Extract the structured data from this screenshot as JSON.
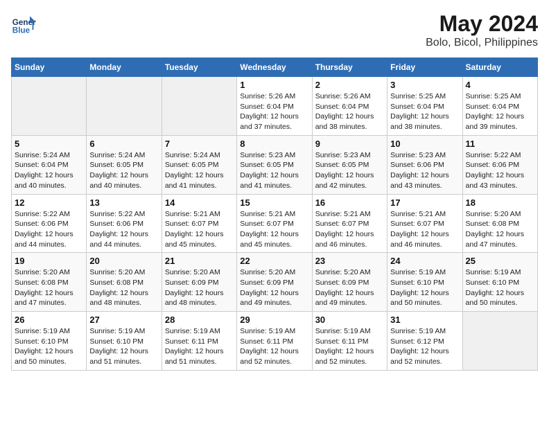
{
  "logo": {
    "line1": "General",
    "line2": "Blue"
  },
  "title": "May 2024",
  "subtitle": "Bolo, Bicol, Philippines",
  "weekdays": [
    "Sunday",
    "Monday",
    "Tuesday",
    "Wednesday",
    "Thursday",
    "Friday",
    "Saturday"
  ],
  "weeks": [
    [
      {
        "day": "",
        "sunrise": "",
        "sunset": "",
        "daylight": ""
      },
      {
        "day": "",
        "sunrise": "",
        "sunset": "",
        "daylight": ""
      },
      {
        "day": "",
        "sunrise": "",
        "sunset": "",
        "daylight": ""
      },
      {
        "day": "1",
        "sunrise": "Sunrise: 5:26 AM",
        "sunset": "Sunset: 6:04 PM",
        "daylight": "Daylight: 12 hours and 37 minutes."
      },
      {
        "day": "2",
        "sunrise": "Sunrise: 5:26 AM",
        "sunset": "Sunset: 6:04 PM",
        "daylight": "Daylight: 12 hours and 38 minutes."
      },
      {
        "day": "3",
        "sunrise": "Sunrise: 5:25 AM",
        "sunset": "Sunset: 6:04 PM",
        "daylight": "Daylight: 12 hours and 38 minutes."
      },
      {
        "day": "4",
        "sunrise": "Sunrise: 5:25 AM",
        "sunset": "Sunset: 6:04 PM",
        "daylight": "Daylight: 12 hours and 39 minutes."
      }
    ],
    [
      {
        "day": "5",
        "sunrise": "Sunrise: 5:24 AM",
        "sunset": "Sunset: 6:04 PM",
        "daylight": "Daylight: 12 hours and 40 minutes."
      },
      {
        "day": "6",
        "sunrise": "Sunrise: 5:24 AM",
        "sunset": "Sunset: 6:05 PM",
        "daylight": "Daylight: 12 hours and 40 minutes."
      },
      {
        "day": "7",
        "sunrise": "Sunrise: 5:24 AM",
        "sunset": "Sunset: 6:05 PM",
        "daylight": "Daylight: 12 hours and 41 minutes."
      },
      {
        "day": "8",
        "sunrise": "Sunrise: 5:23 AM",
        "sunset": "Sunset: 6:05 PM",
        "daylight": "Daylight: 12 hours and 41 minutes."
      },
      {
        "day": "9",
        "sunrise": "Sunrise: 5:23 AM",
        "sunset": "Sunset: 6:05 PM",
        "daylight": "Daylight: 12 hours and 42 minutes."
      },
      {
        "day": "10",
        "sunrise": "Sunrise: 5:23 AM",
        "sunset": "Sunset: 6:06 PM",
        "daylight": "Daylight: 12 hours and 43 minutes."
      },
      {
        "day": "11",
        "sunrise": "Sunrise: 5:22 AM",
        "sunset": "Sunset: 6:06 PM",
        "daylight": "Daylight: 12 hours and 43 minutes."
      }
    ],
    [
      {
        "day": "12",
        "sunrise": "Sunrise: 5:22 AM",
        "sunset": "Sunset: 6:06 PM",
        "daylight": "Daylight: 12 hours and 44 minutes."
      },
      {
        "day": "13",
        "sunrise": "Sunrise: 5:22 AM",
        "sunset": "Sunset: 6:06 PM",
        "daylight": "Daylight: 12 hours and 44 minutes."
      },
      {
        "day": "14",
        "sunrise": "Sunrise: 5:21 AM",
        "sunset": "Sunset: 6:07 PM",
        "daylight": "Daylight: 12 hours and 45 minutes."
      },
      {
        "day": "15",
        "sunrise": "Sunrise: 5:21 AM",
        "sunset": "Sunset: 6:07 PM",
        "daylight": "Daylight: 12 hours and 45 minutes."
      },
      {
        "day": "16",
        "sunrise": "Sunrise: 5:21 AM",
        "sunset": "Sunset: 6:07 PM",
        "daylight": "Daylight: 12 hours and 46 minutes."
      },
      {
        "day": "17",
        "sunrise": "Sunrise: 5:21 AM",
        "sunset": "Sunset: 6:07 PM",
        "daylight": "Daylight: 12 hours and 46 minutes."
      },
      {
        "day": "18",
        "sunrise": "Sunrise: 5:20 AM",
        "sunset": "Sunset: 6:08 PM",
        "daylight": "Daylight: 12 hours and 47 minutes."
      }
    ],
    [
      {
        "day": "19",
        "sunrise": "Sunrise: 5:20 AM",
        "sunset": "Sunset: 6:08 PM",
        "daylight": "Daylight: 12 hours and 47 minutes."
      },
      {
        "day": "20",
        "sunrise": "Sunrise: 5:20 AM",
        "sunset": "Sunset: 6:08 PM",
        "daylight": "Daylight: 12 hours and 48 minutes."
      },
      {
        "day": "21",
        "sunrise": "Sunrise: 5:20 AM",
        "sunset": "Sunset: 6:09 PM",
        "daylight": "Daylight: 12 hours and 48 minutes."
      },
      {
        "day": "22",
        "sunrise": "Sunrise: 5:20 AM",
        "sunset": "Sunset: 6:09 PM",
        "daylight": "Daylight: 12 hours and 49 minutes."
      },
      {
        "day": "23",
        "sunrise": "Sunrise: 5:20 AM",
        "sunset": "Sunset: 6:09 PM",
        "daylight": "Daylight: 12 hours and 49 minutes."
      },
      {
        "day": "24",
        "sunrise": "Sunrise: 5:19 AM",
        "sunset": "Sunset: 6:10 PM",
        "daylight": "Daylight: 12 hours and 50 minutes."
      },
      {
        "day": "25",
        "sunrise": "Sunrise: 5:19 AM",
        "sunset": "Sunset: 6:10 PM",
        "daylight": "Daylight: 12 hours and 50 minutes."
      }
    ],
    [
      {
        "day": "26",
        "sunrise": "Sunrise: 5:19 AM",
        "sunset": "Sunset: 6:10 PM",
        "daylight": "Daylight: 12 hours and 50 minutes."
      },
      {
        "day": "27",
        "sunrise": "Sunrise: 5:19 AM",
        "sunset": "Sunset: 6:10 PM",
        "daylight": "Daylight: 12 hours and 51 minutes."
      },
      {
        "day": "28",
        "sunrise": "Sunrise: 5:19 AM",
        "sunset": "Sunset: 6:11 PM",
        "daylight": "Daylight: 12 hours and 51 minutes."
      },
      {
        "day": "29",
        "sunrise": "Sunrise: 5:19 AM",
        "sunset": "Sunset: 6:11 PM",
        "daylight": "Daylight: 12 hours and 52 minutes."
      },
      {
        "day": "30",
        "sunrise": "Sunrise: 5:19 AM",
        "sunset": "Sunset: 6:11 PM",
        "daylight": "Daylight: 12 hours and 52 minutes."
      },
      {
        "day": "31",
        "sunrise": "Sunrise: 5:19 AM",
        "sunset": "Sunset: 6:12 PM",
        "daylight": "Daylight: 12 hours and 52 minutes."
      },
      {
        "day": "",
        "sunrise": "",
        "sunset": "",
        "daylight": ""
      }
    ]
  ]
}
